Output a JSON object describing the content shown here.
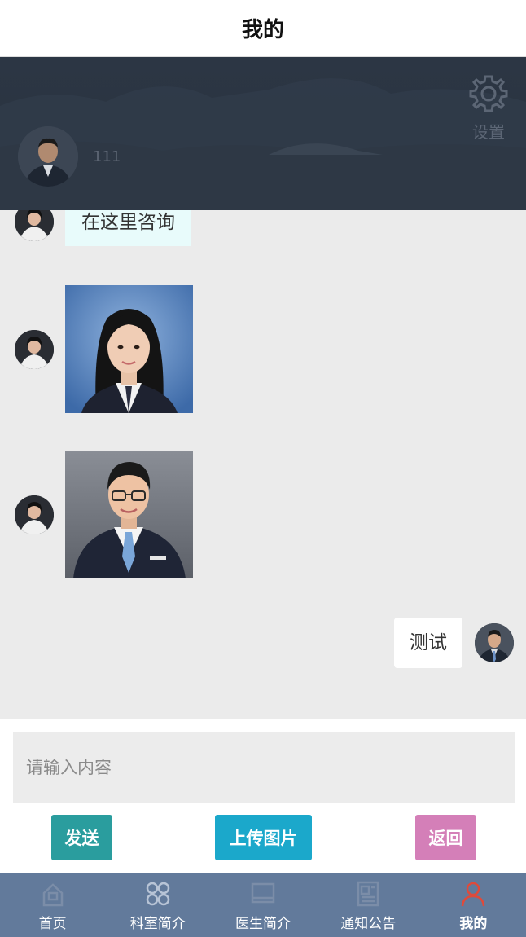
{
  "header": {
    "title": "我的"
  },
  "profile": {
    "name": "111",
    "settings_label": "设置"
  },
  "chat": {
    "messages": [
      {
        "side": "left",
        "type": "text",
        "text": "在这里咨询"
      },
      {
        "side": "left",
        "type": "image",
        "image": "portrait-woman"
      },
      {
        "side": "left",
        "type": "image",
        "image": "portrait-man"
      },
      {
        "side": "right",
        "type": "text",
        "text": "测试"
      }
    ]
  },
  "composer": {
    "placeholder": "请输入内容",
    "send_label": "发送",
    "upload_label": "上传图片",
    "back_label": "返回"
  },
  "tabbar": {
    "items": [
      {
        "label": "首页",
        "icon": "home-icon"
      },
      {
        "label": "科室简介",
        "icon": "grid-icon"
      },
      {
        "label": "医生简介",
        "icon": "doctor-icon"
      },
      {
        "label": "通知公告",
        "icon": "notice-icon"
      },
      {
        "label": "我的",
        "icon": "user-icon",
        "active": true
      }
    ],
    "active_color": "#e04a3a"
  }
}
